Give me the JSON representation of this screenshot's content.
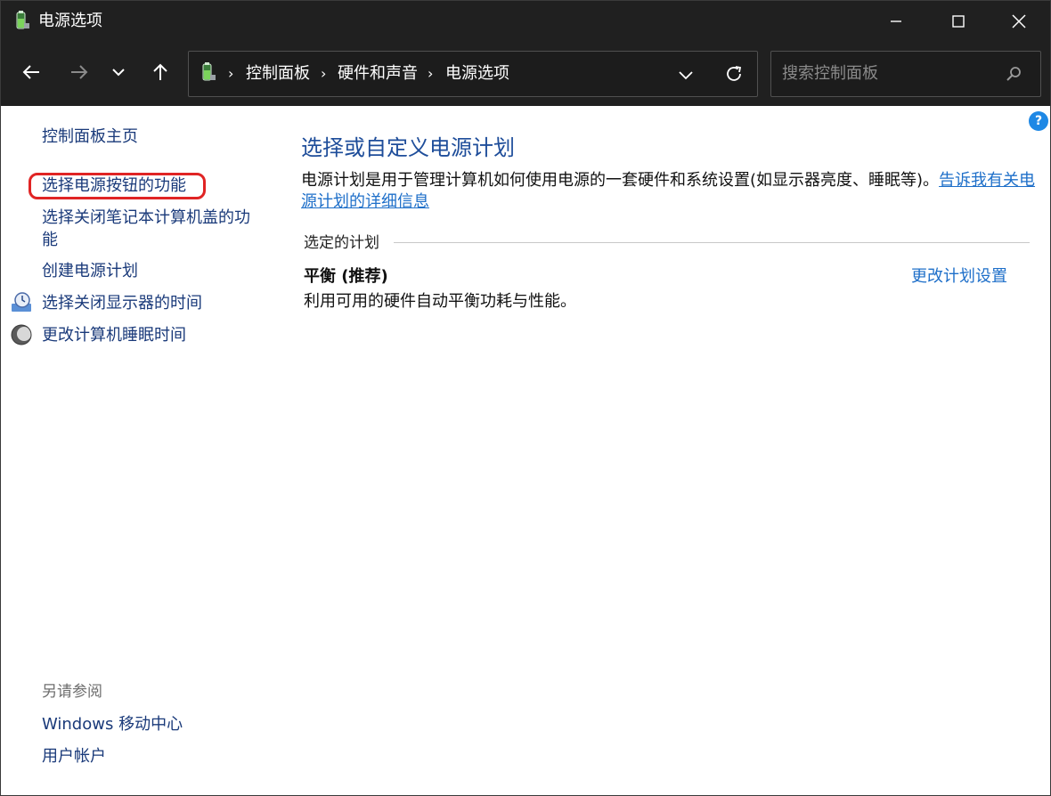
{
  "window": {
    "title": "电源选项",
    "icon": "battery-plug-icon"
  },
  "nav": {
    "back_icon": "back-arrow-icon",
    "forward_icon": "forward-arrow-icon",
    "recent_icon": "chevron-down-icon",
    "up_icon": "up-arrow-icon",
    "breadcrumbs": [
      "控制面板",
      "硬件和声音",
      "电源选项"
    ],
    "breadcrumb_separator": "›",
    "search_placeholder": "搜索控制面板"
  },
  "sidebar": {
    "home_link": "控制面板主页",
    "tasks": [
      {
        "label": "选择电源按钮的功能"
      },
      {
        "label": "选择关闭笔记本计算机盖的功能"
      },
      {
        "label": "创建电源计划"
      },
      {
        "label": "选择关闭显示器的时间",
        "icon": "display-timer-icon"
      },
      {
        "label": "更改计算机睡眠时间",
        "icon": "moon-sleep-icon"
      }
    ],
    "see_also_header": "另请参阅",
    "see_also": [
      "Windows 移动中心",
      "用户帐户"
    ]
  },
  "main": {
    "title": "选择或自定义电源计划",
    "description": "电源计划是用于管理计算机如何使用电源的一套硬件和系统设置(如显示器亮度、睡眠等)。",
    "learn_more_link": "告诉我有关电源计划的详细信息",
    "section_label": "选定的计划",
    "plan": {
      "name": "平衡 (推荐)",
      "description": "利用可用的硬件自动平衡功耗与性能。",
      "change_link": "更改计划设置"
    },
    "help_label": "?"
  },
  "colors": {
    "titlebar_bg": "#202020",
    "link_blue": "#1e6fc9",
    "title_blue": "#1e4d9a",
    "highlight_red": "#e02424"
  }
}
